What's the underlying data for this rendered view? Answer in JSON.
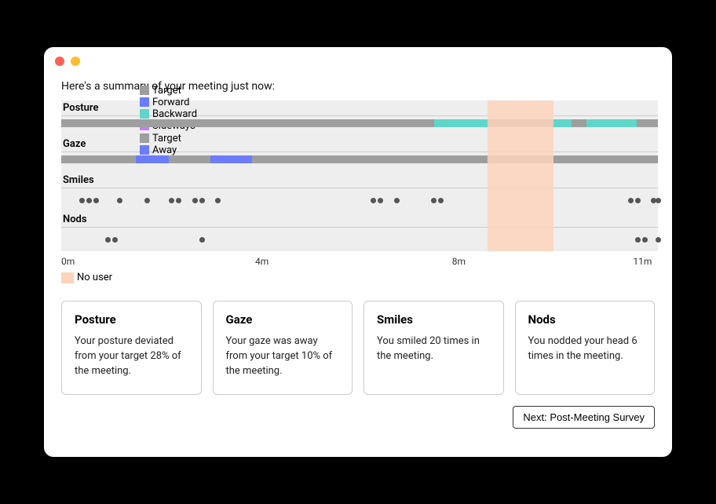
{
  "summary_title": "Here's a summary of your meeting just now:",
  "axis": {
    "labels": [
      "0m",
      "4m",
      "8m",
      "11m"
    ],
    "positions_pct": [
      0,
      32.5,
      65.5,
      99
    ]
  },
  "no_user_label": "No user",
  "no_user_region_pct": {
    "start": 71.5,
    "end": 82.5
  },
  "colors": {
    "target": "#9e9e9e",
    "forward": "#6b7cff",
    "backward": "#5fd6c9",
    "sideways": "#c77dff",
    "away": "#6b7cff",
    "dot": "#555",
    "nouser": "#fcd3bb"
  },
  "posture": {
    "name": "Posture",
    "legend": [
      {
        "label": "Target",
        "color": "#9e9e9e"
      },
      {
        "label": "Forward",
        "color": "#6b7cff"
      },
      {
        "label": "Backward",
        "color": "#5fd6c9"
      },
      {
        "label": "Sideways",
        "color": "#c77dff"
      }
    ],
    "segments": [
      {
        "start": 62.5,
        "end": 71.5,
        "color": "#5fd6c9"
      },
      {
        "start": 82.5,
        "end": 85.5,
        "color": "#5fd6c9"
      },
      {
        "start": 88.0,
        "end": 96.5,
        "color": "#5fd6c9"
      }
    ]
  },
  "gaze": {
    "name": "Gaze",
    "legend": [
      {
        "label": "Target",
        "color": "#9e9e9e"
      },
      {
        "label": "Away",
        "color": "#6b7cff"
      }
    ],
    "segments": [
      {
        "start": 12.5,
        "end": 18.0,
        "color": "#6b7cff"
      },
      {
        "start": 25.0,
        "end": 32.0,
        "color": "#6b7cff"
      }
    ]
  },
  "smiles": {
    "name": "Smiles",
    "points_pct": [
      3.0,
      4.2,
      5.4,
      9.4,
      14.0,
      18.0,
      19.2,
      22.0,
      23.2,
      25.8,
      51.8,
      53.0,
      55.8,
      62.0,
      63.2,
      95.0,
      96.2,
      98.8,
      99.6
    ]
  },
  "nods": {
    "name": "Nods",
    "points_pct": [
      7.4,
      8.6,
      23.2,
      96.2,
      97.4,
      99.6
    ]
  },
  "cards": [
    {
      "title": "Posture",
      "text": "Your posture deviated from your target 28% of the meeting."
    },
    {
      "title": "Gaze",
      "text": "Your gaze was away from your target 10% of the meeting."
    },
    {
      "title": "Smiles",
      "text": "You smiled 20 times in the meeting."
    },
    {
      "title": "Nods",
      "text": "You nodded your head 6 times in the meeting."
    }
  ],
  "next_button": "Next: Post-Meeting Survey",
  "chart_data": {
    "type": "timeline",
    "duration_minutes": 11,
    "no_user_interval_minutes": [
      7.9,
      9.1
    ],
    "posture_backward_intervals_minutes": [
      [
        6.9,
        7.9
      ],
      [
        9.1,
        9.4
      ],
      [
        9.7,
        10.6
      ]
    ],
    "gaze_away_intervals_minutes": [
      [
        1.4,
        2.0
      ],
      [
        2.75,
        3.5
      ]
    ],
    "smile_events_minutes": [
      0.33,
      0.46,
      0.59,
      1.03,
      1.54,
      1.98,
      2.11,
      2.42,
      2.55,
      2.84,
      5.7,
      5.83,
      6.14,
      6.82,
      6.95,
      10.45,
      10.58,
      10.87,
      10.96
    ],
    "nod_events_minutes": [
      0.81,
      0.95,
      2.55,
      10.58,
      10.71,
      10.96
    ]
  }
}
